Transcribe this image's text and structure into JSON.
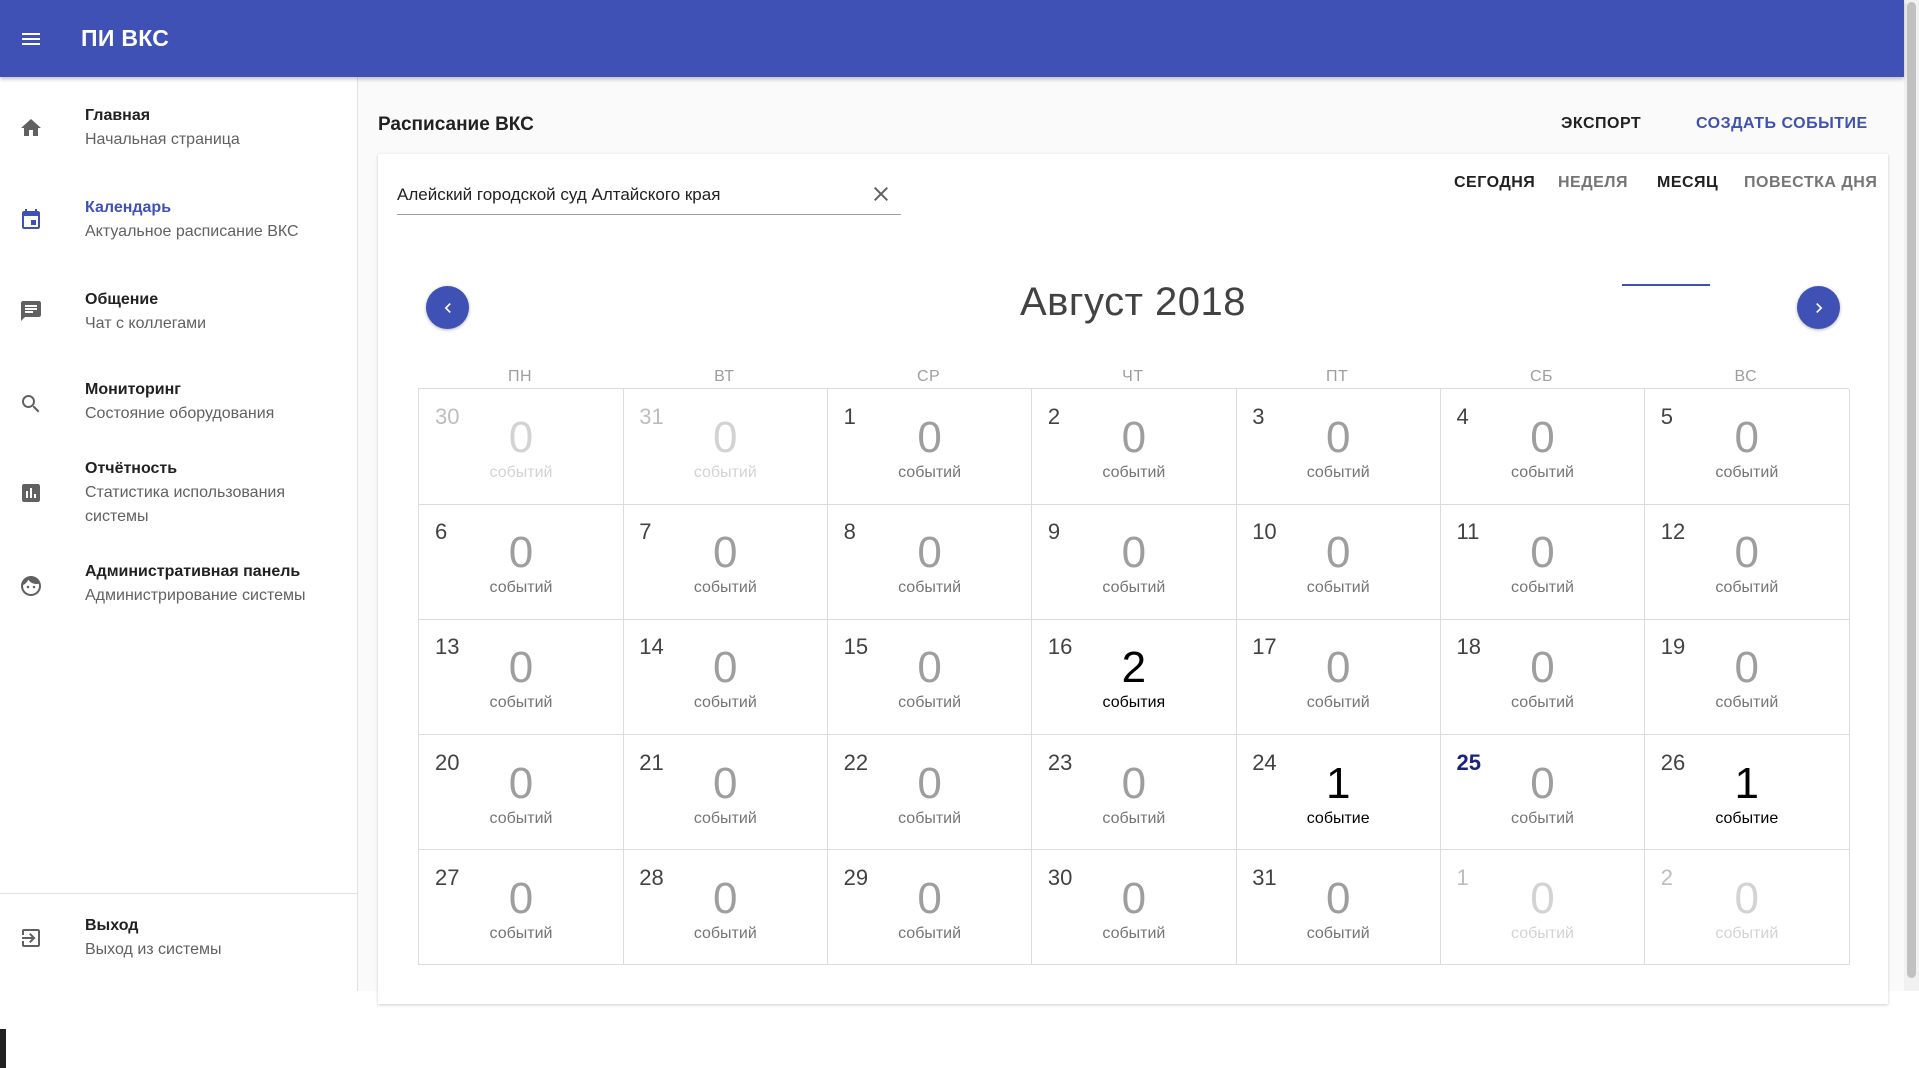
{
  "app": {
    "title": "ПИ ВКС"
  },
  "sidebar": {
    "items": [
      {
        "title": "Главная",
        "subtitle": "Начальная страница"
      },
      {
        "title": "Календарь",
        "subtitle": "Актуальное расписание ВКС"
      },
      {
        "title": "Общение",
        "subtitle": "Чат с коллегами"
      },
      {
        "title": "Мониторинг",
        "subtitle": "Состояние оборудования"
      },
      {
        "title": "Отчётность",
        "subtitle": "Статистика использования системы"
      },
      {
        "title": "Административная панель",
        "subtitle": "Администрирование системы"
      }
    ],
    "logout": {
      "title": "Выход",
      "subtitle": "Выход из системы"
    }
  },
  "header": {
    "page_title": "Расписание ВКС",
    "export_label": "Экспорт",
    "create_label": "Создать событие"
  },
  "filter": {
    "value": "Алейский городской суд Алтайского края"
  },
  "view_tabs": {
    "today": "Сегодня",
    "week": "Неделя",
    "month": "Месяц",
    "agenda": "Повестка дня",
    "selected": "Месяц"
  },
  "calendar": {
    "month_title": "Август 2018",
    "weekdays": [
      "ПН",
      "ВТ",
      "СР",
      "ЧТ",
      "ПТ",
      "СБ",
      "ВС"
    ],
    "weeks": [
      [
        {
          "day": "30",
          "count": "0",
          "label": "событий",
          "other": true
        },
        {
          "day": "31",
          "count": "0",
          "label": "событий",
          "other": true
        },
        {
          "day": "1",
          "count": "0",
          "label": "событий"
        },
        {
          "day": "2",
          "count": "0",
          "label": "событий"
        },
        {
          "day": "3",
          "count": "0",
          "label": "событий"
        },
        {
          "day": "4",
          "count": "0",
          "label": "событий"
        },
        {
          "day": "5",
          "count": "0",
          "label": "событий"
        }
      ],
      [
        {
          "day": "6",
          "count": "0",
          "label": "событий"
        },
        {
          "day": "7",
          "count": "0",
          "label": "событий"
        },
        {
          "day": "8",
          "count": "0",
          "label": "событий"
        },
        {
          "day": "9",
          "count": "0",
          "label": "событий"
        },
        {
          "day": "10",
          "count": "0",
          "label": "событий"
        },
        {
          "day": "11",
          "count": "0",
          "label": "событий"
        },
        {
          "day": "12",
          "count": "0",
          "label": "событий"
        }
      ],
      [
        {
          "day": "13",
          "count": "0",
          "label": "событий"
        },
        {
          "day": "14",
          "count": "0",
          "label": "событий"
        },
        {
          "day": "15",
          "count": "0",
          "label": "событий"
        },
        {
          "day": "16",
          "count": "2",
          "label": "события"
        },
        {
          "day": "17",
          "count": "0",
          "label": "событий"
        },
        {
          "day": "18",
          "count": "0",
          "label": "событий"
        },
        {
          "day": "19",
          "count": "0",
          "label": "событий"
        }
      ],
      [
        {
          "day": "20",
          "count": "0",
          "label": "событий"
        },
        {
          "day": "21",
          "count": "0",
          "label": "событий"
        },
        {
          "day": "22",
          "count": "0",
          "label": "событий"
        },
        {
          "day": "23",
          "count": "0",
          "label": "событий"
        },
        {
          "day": "24",
          "count": "1",
          "label": "событие"
        },
        {
          "day": "25",
          "count": "0",
          "label": "событий",
          "today": true
        },
        {
          "day": "26",
          "count": "1",
          "label": "событие"
        }
      ],
      [
        {
          "day": "27",
          "count": "0",
          "label": "событий"
        },
        {
          "day": "28",
          "count": "0",
          "label": "событий"
        },
        {
          "day": "29",
          "count": "0",
          "label": "событий"
        },
        {
          "day": "30",
          "count": "0",
          "label": "событий"
        },
        {
          "day": "31",
          "count": "0",
          "label": "событий"
        },
        {
          "day": "1",
          "count": "0",
          "label": "событий",
          "other": true
        },
        {
          "day": "2",
          "count": "0",
          "label": "событий",
          "other": true
        }
      ]
    ]
  },
  "colors": {
    "primary": "#3f51b5",
    "today": "#1a237e"
  }
}
